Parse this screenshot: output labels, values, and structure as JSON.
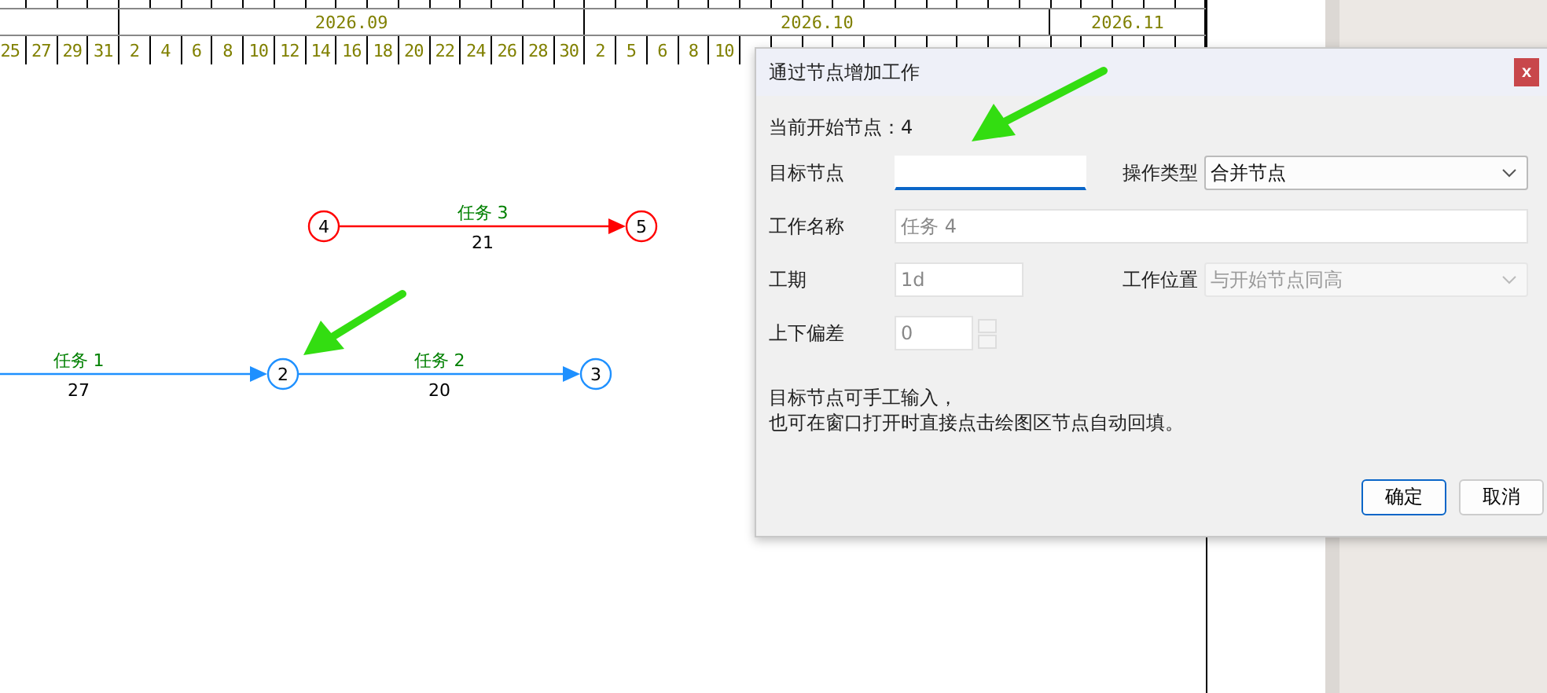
{
  "timeline": {
    "months": [
      {
        "days": [
          "25",
          "27",
          "29",
          "31"
        ]
      },
      {
        "label": "2026.09",
        "days": [
          "2",
          "4",
          "6",
          "8",
          "10",
          "12",
          "14",
          "16",
          "18",
          "20",
          "22",
          "24",
          "26",
          "28",
          "30"
        ]
      },
      {
        "label": "2026.10",
        "days": [
          "2",
          "5",
          "6",
          "8",
          "10"
        ]
      },
      {
        "label": "2026.11"
      }
    ]
  },
  "network": {
    "nodes": [
      {
        "label": "2",
        "color": "#1e90ff"
      },
      {
        "label": "3",
        "color": "#1e90ff"
      },
      {
        "label": "4",
        "color": "#ff0000"
      },
      {
        "label": "5",
        "color": "#ff0000"
      }
    ],
    "edges": [
      {
        "name": "任务 1",
        "duration": "27",
        "color": "#1e90ff"
      },
      {
        "name": "任务 2",
        "duration": "20",
        "color": "#1e90ff"
      },
      {
        "name": "任务 3",
        "duration": "21",
        "color": "#ff0000"
      }
    ]
  },
  "dialog": {
    "title": "通过节点增加工作",
    "close": "x",
    "current_node": "当前开始节点：4",
    "fields": [
      {
        "kind": "input",
        "label": "目标节点",
        "focused": true
      },
      {
        "kind": "select",
        "label": "操作类型",
        "value": "合并节点",
        "disabled": false
      },
      {
        "kind": "input",
        "label": "工作名称",
        "placeholder": "任务 4",
        "focused": false
      },
      {
        "kind": "input",
        "label": "工期",
        "placeholder": "1d",
        "focused": false
      },
      {
        "kind": "select",
        "label": "工作位置",
        "value": "与开始节点同高",
        "disabled": true
      },
      {
        "kind": "spinner",
        "label": "上下偏差",
        "placeholder": "0"
      }
    ],
    "hint": [
      "目标节点可手工输入，",
      "也可在窗口打开时直接点击绘图区节点自动回填。"
    ],
    "buttons": [
      {
        "label": "确定",
        "default": true
      },
      {
        "label": "取消",
        "default": false
      }
    ]
  }
}
